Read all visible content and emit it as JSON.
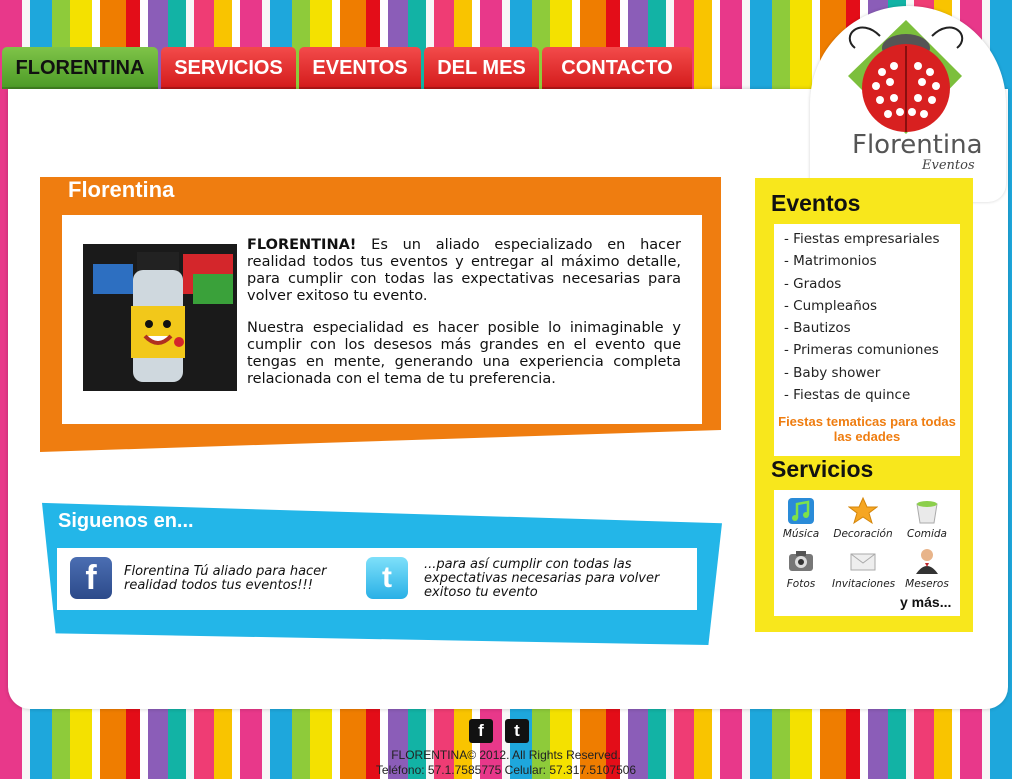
{
  "nav": {
    "items": [
      {
        "label": "FLORENTINA",
        "active": true
      },
      {
        "label": "SERVICIOS"
      },
      {
        "label": "EVENTOS"
      },
      {
        "label": "DEL MES"
      },
      {
        "label": "CONTACTO"
      }
    ]
  },
  "logo": {
    "name": "Florentina",
    "sub": "Eventos",
    "icon": "ladybug-logo"
  },
  "about": {
    "title": "Florentina",
    "lead": "FLORENTINA!",
    "para1": " Es un aliado especializado en hacer realidad todos tus eventos y entregar al máximo detalle, para cumplir con todas las expectativas necesarias para volver exitoso tu evento.",
    "para2": "Nuestra especialidad es hacer posible lo inimaginable y cumplir con los desesos más grandes en el evento que tengas en mente, generando una experiencia completa relacionada con el tema de tu preferencia."
  },
  "social": {
    "title": "Siguenos en...",
    "facebook_text": "Florentina Tú aliado para hacer realidad todos tus eventos!!!",
    "twitter_text": "...para así cumplir con todas las expectativas necesarias para volver exitoso tu evento"
  },
  "events": {
    "title": "Eventos",
    "items": [
      "- Fiestas empresariales",
      "- Matrimonios",
      "- Grados",
      "- Cumpleaños",
      "- Bautizos",
      "- Primeras comuniones",
      "- Baby shower",
      "- Fiestas de quince"
    ],
    "extra": "Fiestas tematicas para todas las edades"
  },
  "services": {
    "title": "Servicios",
    "items": [
      {
        "label": "Música",
        "icon": "music-icon"
      },
      {
        "label": "Decoración",
        "icon": "star-icon"
      },
      {
        "label": "Comida",
        "icon": "cup-icon"
      },
      {
        "label": "Fotos",
        "icon": "camera-icon"
      },
      {
        "label": "Invitaciones",
        "icon": "envelope-icon"
      },
      {
        "label": "Meseros",
        "icon": "waiter-icon"
      }
    ],
    "more": "y más..."
  },
  "footer": {
    "copyright": "FLORENTINA© 2012. All Rights Reserved.",
    "contact": "Teléfono: 57.1.7585775 Celular: 57.317.5107506"
  },
  "colors": {
    "orange": "#ef7d10",
    "blue": "#23b6e8",
    "yellow": "#f8e71c",
    "red": "#e02222",
    "green": "#5aa82e"
  }
}
